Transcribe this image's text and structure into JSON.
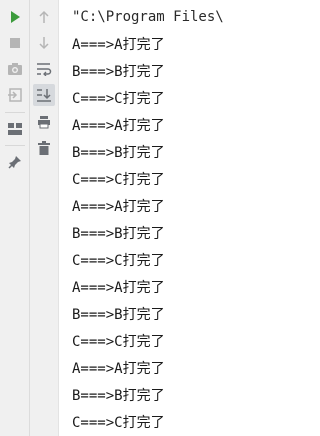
{
  "left_toolbar": {
    "icons": [
      "play-icon",
      "stop-icon",
      "camera-icon",
      "exit-icon",
      "layout-icon",
      "pin-icon"
    ],
    "colors": {
      "run": "#3c9b3c",
      "disabled": "#b5b5b5",
      "icon": "#6b6f75"
    }
  },
  "second_toolbar": {
    "icons": [
      "up-arrow-icon",
      "down-arrow-icon",
      "soft-wrap-icon",
      "scroll-to-end-icon",
      "print-icon",
      "trash-icon"
    ]
  },
  "console": {
    "command": "\"C:\\Program Files\\",
    "lines": [
      "A===>A打完了",
      "B===>B打完了",
      "C===>C打完了",
      "A===>A打完了",
      "B===>B打完了",
      "C===>C打完了",
      "A===>A打完了",
      "B===>B打完了",
      "C===>C打完了",
      "A===>A打完了",
      "B===>B打完了",
      "C===>C打完了",
      "A===>A打完了",
      "B===>B打完了",
      "C===>C打完了"
    ]
  }
}
